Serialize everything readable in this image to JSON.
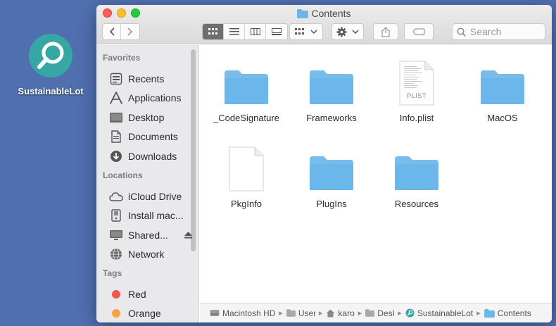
{
  "desktop": {
    "app_icon": {
      "label": "SustainableLot",
      "icon": "magnifier-icon",
      "color": "#37a7a5"
    }
  },
  "window": {
    "title": "Contents",
    "toolbar": {
      "nav": [
        "back",
        "forward"
      ],
      "views": [
        "icon-view",
        "list-view",
        "column-view",
        "gallery-view"
      ],
      "active_view": "icon-view",
      "group_icon": "group-icon",
      "action_icon": "gear-icon",
      "share_icon": "share-icon",
      "tag_icon": "tag-icon",
      "search_placeholder": "Search"
    },
    "sidebar": {
      "favorites_header": "Favorites",
      "favorites": [
        {
          "label": "Recents",
          "icon": "clock-icon"
        },
        {
          "label": "Applications",
          "icon": "applications-icon"
        },
        {
          "label": "Desktop",
          "icon": "desktop-icon"
        },
        {
          "label": "Documents",
          "icon": "document-icon"
        },
        {
          "label": "Downloads",
          "icon": "download-icon"
        }
      ],
      "locations_header": "Locations",
      "locations": [
        {
          "label": "iCloud Drive",
          "icon": "cloud-icon"
        },
        {
          "label": "Install mac...",
          "icon": "disk-icon"
        },
        {
          "label": "Shared...",
          "icon": "display-icon",
          "eject": true
        },
        {
          "label": "Network",
          "icon": "globe-icon"
        }
      ],
      "tags_header": "Tags",
      "tags": [
        {
          "label": "Red",
          "color": "#f0584f"
        },
        {
          "label": "Orange",
          "color": "#f5a33b"
        }
      ]
    },
    "files": [
      {
        "name": "_CodeSignature",
        "kind": "folder"
      },
      {
        "name": "Frameworks",
        "kind": "folder"
      },
      {
        "name": "Info.plist",
        "kind": "plist",
        "badge": "PLIST"
      },
      {
        "name": "MacOS",
        "kind": "folder"
      },
      {
        "name": "PkgInfo",
        "kind": "document"
      },
      {
        "name": "PlugIns",
        "kind": "folder"
      },
      {
        "name": "Resources",
        "kind": "folder"
      }
    ],
    "pathbar": [
      {
        "label": "Macintosh HD",
        "icon": "hard-drive-icon"
      },
      {
        "label": "User",
        "icon": "folder-icon"
      },
      {
        "label": "karo",
        "icon": "home-icon"
      },
      {
        "label": "Desk",
        "icon": "folder-icon"
      },
      {
        "label": "SustainableLot",
        "icon": "app-icon"
      },
      {
        "label": "Contents",
        "icon": "folder-icon"
      }
    ]
  },
  "colors": {
    "desktop_bg": "#4f6fae",
    "folder": "#6bb6ea"
  }
}
